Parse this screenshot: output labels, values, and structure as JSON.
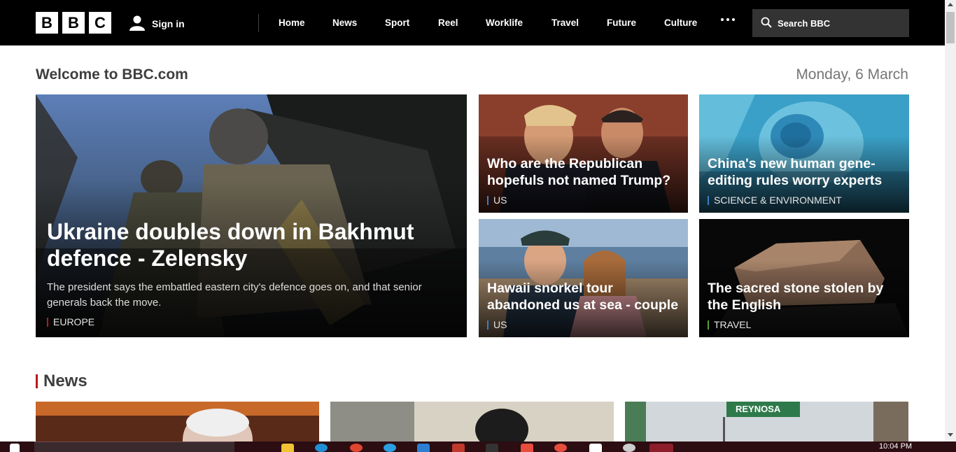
{
  "nav": {
    "logo_letters": [
      "B",
      "B",
      "C"
    ],
    "signin_label": "Sign in",
    "links": [
      "Home",
      "News",
      "Sport",
      "Reel",
      "Worklife",
      "Travel",
      "Future",
      "Culture"
    ],
    "search_placeholder": "Search BBC"
  },
  "welcome": {
    "title": "Welcome to BBC.com",
    "date": "Monday, 6 March"
  },
  "top_stories": {
    "main": {
      "headline": "Ukraine doubles down in Bakhmut defence - Zelensky",
      "summary": "The president says the embattled eastern city's defence goes on, and that senior generals back the move.",
      "tag": "EUROPE",
      "tag_color": "#bb1919"
    },
    "cards": [
      {
        "headline": "Who are the Republican hopefuls not named Trump?",
        "tag": "US",
        "tag_color": "#3f7fc4"
      },
      {
        "headline": "China's new human gene-editing rules worry experts",
        "tag": "SCIENCE & ENVIRONMENT",
        "tag_color": "#3f7fc4"
      },
      {
        "headline": "Hawaii snorkel tour abandoned us at sea - couple",
        "tag": "US",
        "tag_color": "#3f7fc4"
      },
      {
        "headline": "The sacred stone stolen by the English",
        "tag": "TRAVEL",
        "tag_color": "#5f9d3a"
      }
    ]
  },
  "news_section": {
    "title": "News",
    "accent": "#bb1919"
  },
  "taskbar": {
    "time": "10:04 PM"
  }
}
